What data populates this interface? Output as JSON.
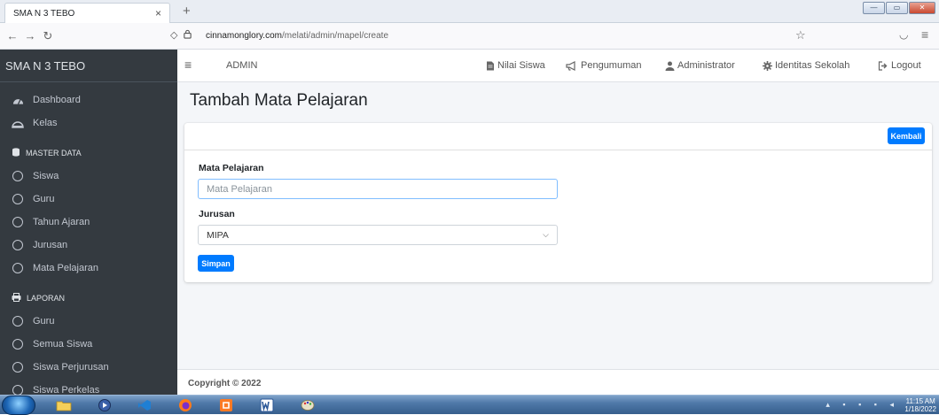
{
  "browser": {
    "tab_title": "SMA N 3 TEBO",
    "tab_close": "×",
    "new_tab": "+",
    "url_host": "cinnamonglory.com",
    "url_path": "/melati/admin/mapel/create"
  },
  "sidebar": {
    "brand": "SMA N 3 TEBO",
    "items": [
      {
        "label": "Dashboard",
        "icon": "dashboard-icon"
      },
      {
        "label": "Kelas",
        "icon": "kelas-icon"
      }
    ],
    "master_header": "MASTER DATA",
    "master_items": [
      "Siswa",
      "Guru",
      "Tahun Ajaran",
      "Jurusan",
      "Mata Pelajaran"
    ],
    "laporan_header": "LAPORAN",
    "laporan_items": [
      "Guru",
      "Semua Siswa",
      "Siswa Perjurusan",
      "Siswa Perkelas"
    ]
  },
  "topnav": {
    "admin": "ADMIN",
    "links": [
      {
        "label": "Nilai Siswa",
        "icon": "file-icon"
      },
      {
        "label": "Pengumuman",
        "icon": "bullhorn-icon"
      },
      {
        "label": "Administrator",
        "icon": "user-icon"
      },
      {
        "label": "Identitas Sekolah",
        "icon": "gear-icon"
      },
      {
        "label": "Logout",
        "icon": "logout-icon"
      }
    ]
  },
  "page": {
    "title": "Tambah Mata Pelajaran",
    "back_button": "Kembali",
    "field1_label": "Mata Pelajaran",
    "field1_placeholder": "Mata Pelajaran",
    "field1_value": "",
    "field2_label": "Jurusan",
    "field2_value": "MIPA",
    "submit_button": "Simpan"
  },
  "footer": {
    "copyright": "Copyright © 2022"
  },
  "taskbar": {
    "time": "11:15 AM",
    "date": "1/18/2022"
  },
  "colors": {
    "primary": "#007bff",
    "sidebar_bg": "#343a40",
    "content_bg": "#f4f6f9"
  }
}
